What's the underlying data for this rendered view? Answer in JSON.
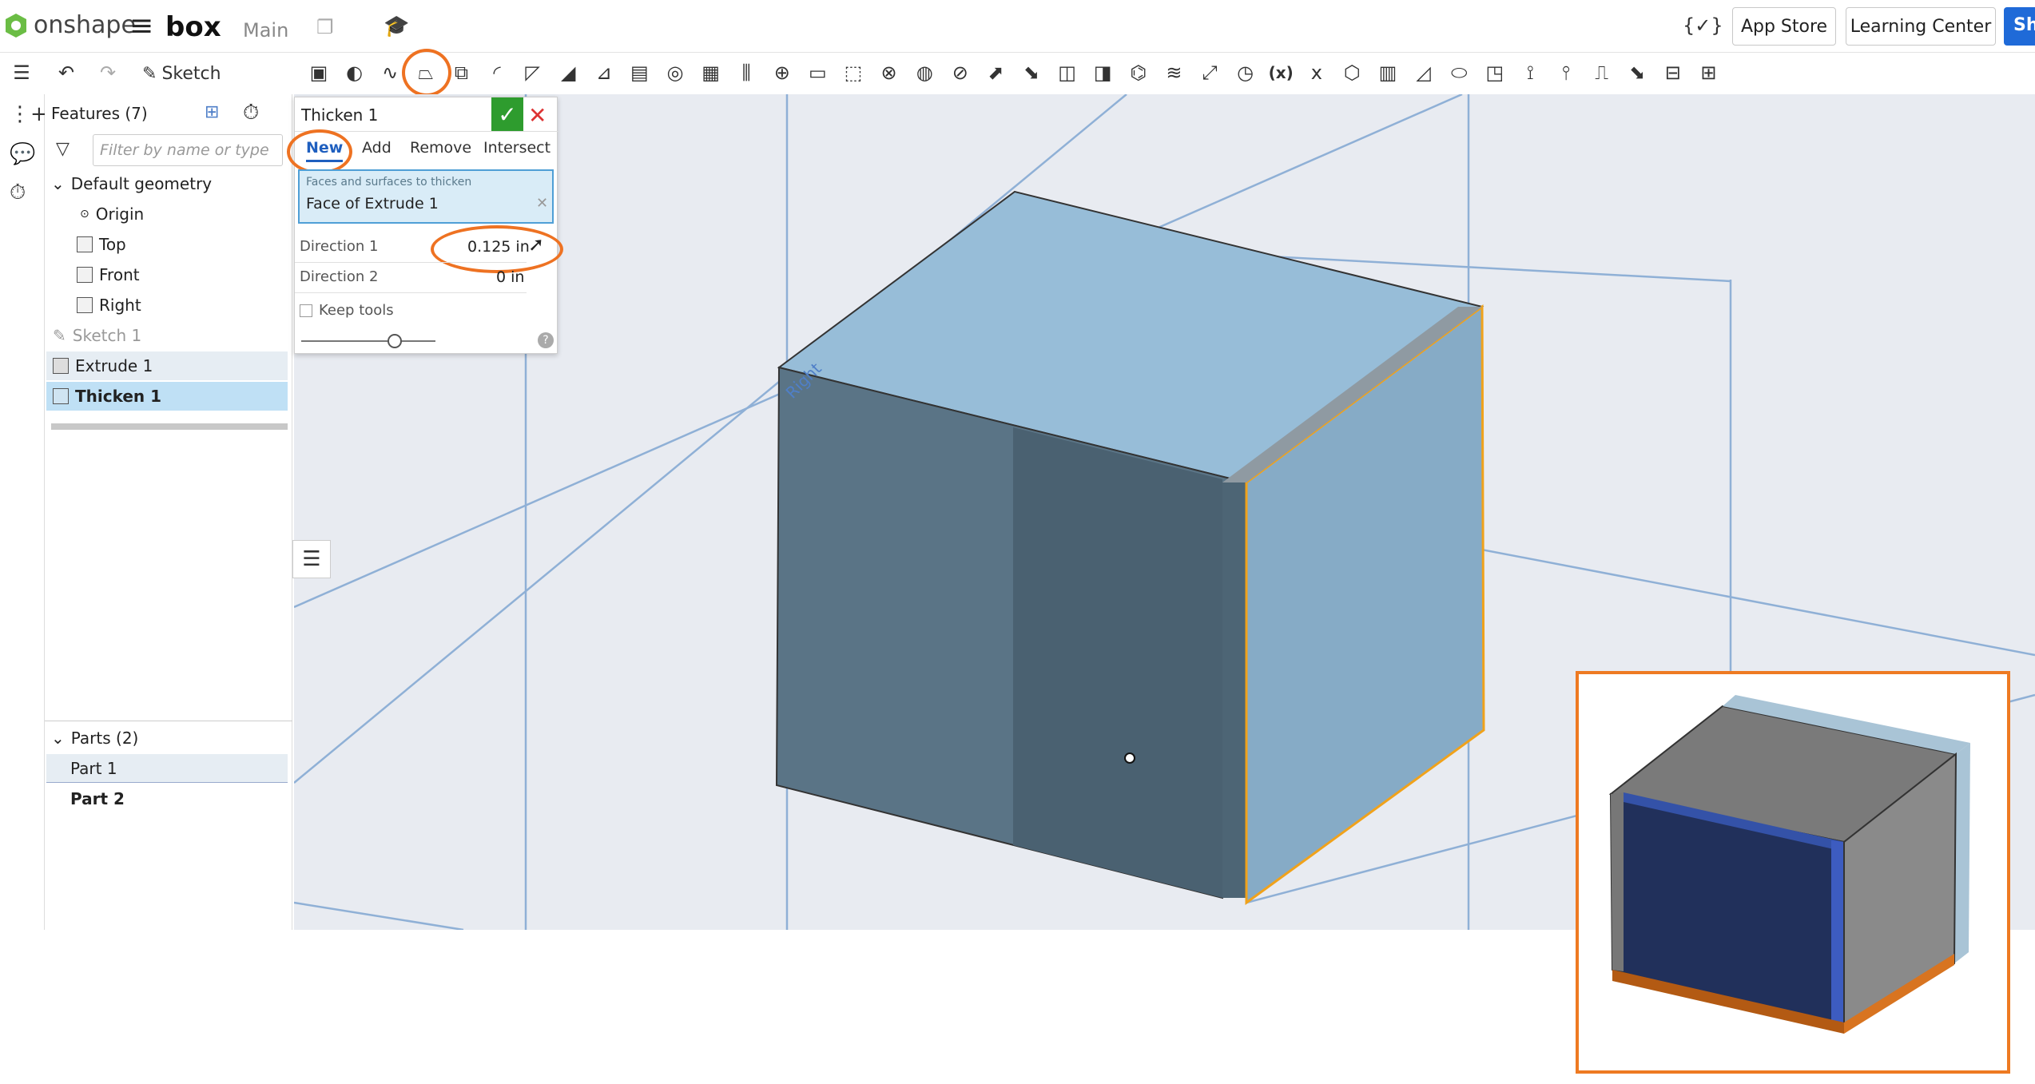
{
  "topbar": {
    "brand": "onshape",
    "doc_title": "box",
    "workspace": "Main",
    "app_store": "App Store",
    "learning_center": "Learning Center",
    "share": "Sh"
  },
  "toolbar": {
    "sketch_label": "Sketch",
    "variable_label": "(x)",
    "tools": [
      "extrude-icon",
      "revolve-icon",
      "sweep-icon",
      "loft-icon",
      "thicken-icon",
      "fillet-icon",
      "chamfer-icon",
      "draft-icon",
      "rib-icon",
      "shell-icon",
      "hole-icon",
      "pattern-icon",
      "mirror-icon",
      "boolean-icon",
      "split-icon",
      "transform-icon",
      "delete-part-icon",
      "modify-fillet-icon",
      "delete-face-icon",
      "move-face-icon",
      "replace-face-icon",
      "offset-surface-icon",
      "plane-icon",
      "mate-connector-icon",
      "helix-icon",
      "explode-icon",
      "measure-icon",
      "variable-icon",
      "sheet-metal-icon",
      "frame-icon",
      "rib-2-icon",
      "wrap-icon",
      "flange-icon",
      "corner-icon",
      "tab-icon",
      "jog-icon",
      "text-icon",
      "thread-icon",
      "section-icon",
      "add-icon"
    ]
  },
  "tree": {
    "header": "Features (7)",
    "filter_placeholder": "Filter by name or type",
    "default_geometry": "Default geometry",
    "origin": "Origin",
    "top": "Top",
    "front": "Front",
    "right": "Right",
    "sketch1": "Sketch 1",
    "extrude1": "Extrude 1",
    "thicken1": "Thicken 1",
    "parts_header": "Parts (2)",
    "part1": "Part 1",
    "part2": "Part 2"
  },
  "dialog": {
    "title": "Thicken 1",
    "tabs": {
      "new": "New",
      "add": "Add",
      "remove": "Remove",
      "intersect": "Intersect"
    },
    "faces_label": "Faces and surfaces to thicken",
    "faces_value": "Face of Extrude 1",
    "direction1_label": "Direction 1",
    "direction1_value": "0.125 in",
    "direction2_label": "Direction 2",
    "direction2_value": "0 in",
    "keep_tools": "Keep tools",
    "help": "?"
  },
  "viewport": {
    "plane_label": "Right"
  },
  "colors": {
    "highlight": "#ee7222",
    "accent_blue": "#1f6ad8",
    "selection": "#cde7f5",
    "ok_green": "#2e9c2e"
  }
}
